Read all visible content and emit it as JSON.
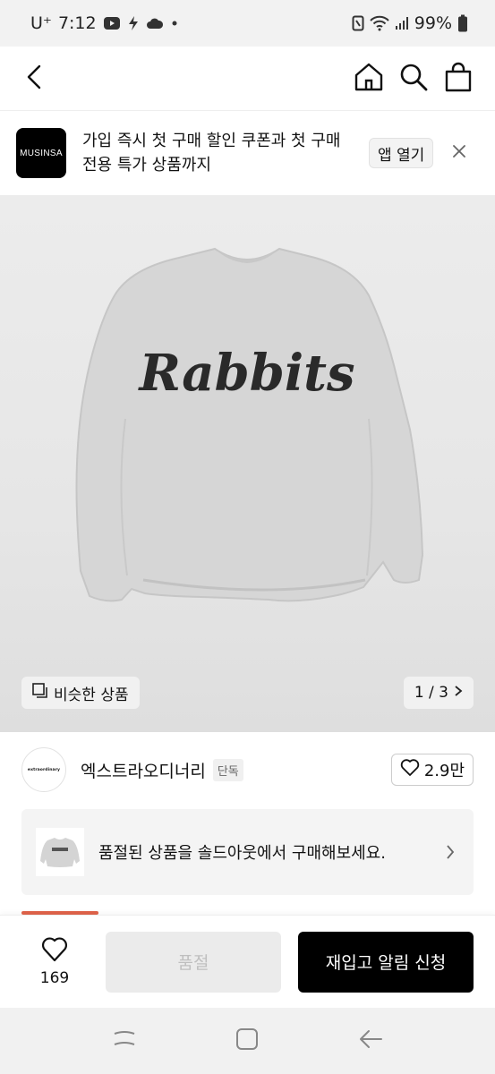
{
  "status_bar": {
    "carrier": "U⁺",
    "time": "7:12",
    "battery": "99%",
    "icons": [
      "youtube-icon",
      "bolt-icon",
      "cloud-icon",
      "dot-icon",
      "nfc-icon",
      "wifi-icon",
      "signal-icon",
      "battery-icon"
    ]
  },
  "header": {
    "icons": [
      "back-arrow-icon",
      "home-icon",
      "search-icon",
      "shopping-bag-icon"
    ]
  },
  "promo": {
    "logo_text": "MUSINSA",
    "message": "가입 즉시 첫 구매 할인 쿠폰과 첫 구매 전용 특가 상품까지",
    "open_app_label": "앱 열기"
  },
  "product_image": {
    "print_text": "Rabbits",
    "similar_label": "비슷한 상품",
    "pager": "1 / 3",
    "colors": {
      "garment": "#d3d3d3",
      "print": "#2a2a2a"
    }
  },
  "brand": {
    "logo_text": "extraordinary",
    "name": "엑스트라오디너리",
    "tag": "단독",
    "likes": "2.9만"
  },
  "soldout_banner": {
    "message": "품절된 상품을 솔드아웃에서 구매해보세요."
  },
  "action_bar": {
    "like_count": "169",
    "soldout_label": "품절",
    "restock_label": "재입고 알림 신청"
  },
  "colors": {
    "accent": "#e0634a",
    "primary_button": "#000000"
  }
}
